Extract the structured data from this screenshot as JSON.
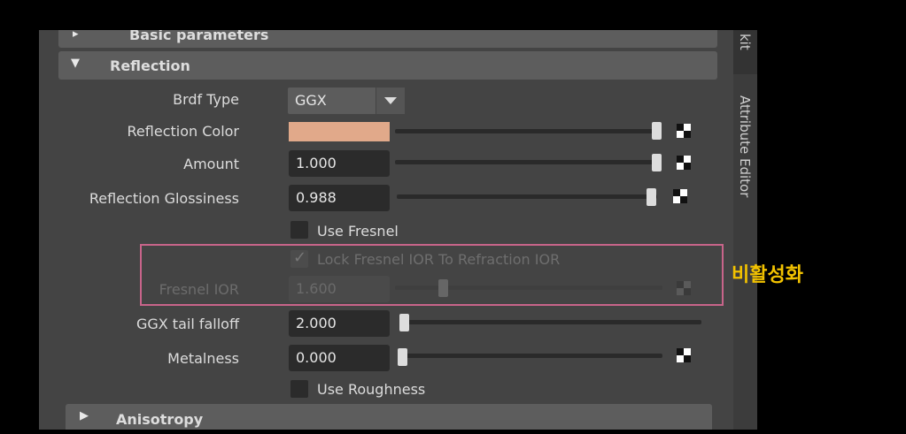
{
  "sections": {
    "basic": "Basic parameters",
    "reflection": "Reflection",
    "anisotropy": "Anisotropy"
  },
  "side_tabs": {
    "toolkit": "kit",
    "attribute_editor": "Attribute Editor"
  },
  "reflection": {
    "brdf_type": {
      "label": "Brdf Type",
      "value": "GGX"
    },
    "reflection_color": {
      "label": "Reflection Color",
      "color": "#e1a98a",
      "slider": 1.0
    },
    "amount": {
      "label": "Amount",
      "value": "1.000",
      "slider": 1.0
    },
    "glossiness": {
      "label": "Reflection Glossiness",
      "value": "0.988",
      "slider": 0.988
    },
    "use_fresnel": {
      "label": "Use Fresnel",
      "checked": false
    },
    "lock_fresnel": {
      "label": "Lock Fresnel IOR To Refraction IOR",
      "checked": true,
      "disabled": true
    },
    "fresnel_ior": {
      "label": "Fresnel IOR",
      "value": "1.600",
      "disabled": true
    },
    "ggx_tail": {
      "label": "GGX tail falloff",
      "value": "2.000"
    },
    "metalness": {
      "label": "Metalness",
      "value": "0.000",
      "slider": 0.0
    },
    "use_roughness": {
      "label": "Use Roughness",
      "checked": false
    }
  },
  "annotation": "비활성화",
  "colors": {
    "highlight": "#c8648a",
    "annotation": "#f2c200",
    "swatch": "#e1a98a"
  }
}
